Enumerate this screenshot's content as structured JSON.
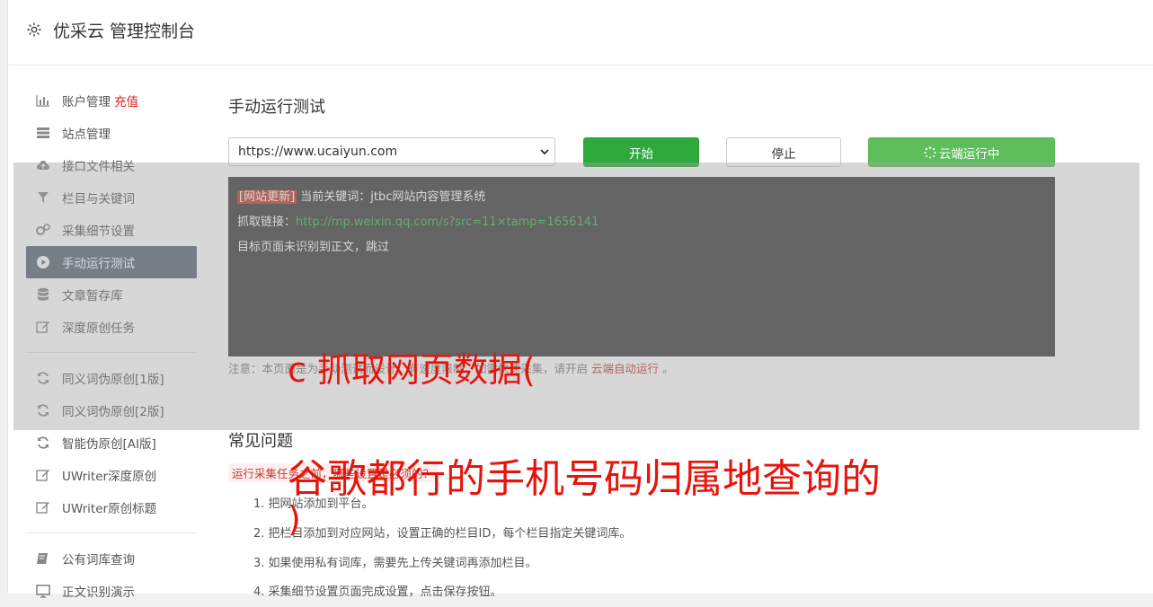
{
  "header": {
    "title": "优采云 管理控制台",
    "icon": "gear-icon"
  },
  "sidebar": {
    "group1": [
      {
        "label": "账户管理",
        "tag": "充值",
        "icon": "bar-chart-icon"
      },
      {
        "label": "站点管理",
        "icon": "list-icon"
      },
      {
        "label": "接口文件相关",
        "icon": "cloud-upload-icon"
      },
      {
        "label": "栏目与关键词",
        "icon": "filter-icon"
      },
      {
        "label": "采集细节设置",
        "icon": "cogs-icon"
      },
      {
        "label": "手动运行测试",
        "icon": "play-icon",
        "active": true
      },
      {
        "label": "文章暂存库",
        "icon": "database-icon"
      },
      {
        "label": "深度原创任务",
        "icon": "edit-icon"
      }
    ],
    "group2": [
      {
        "label": "同义词伪原创[1版]",
        "icon": "refresh-icon"
      },
      {
        "label": "同义词伪原创[2版]",
        "icon": "refresh-icon"
      },
      {
        "label": "智能伪原创[AI版]",
        "icon": "refresh-icon"
      },
      {
        "label": "UWriter深度原创",
        "icon": "edit-icon"
      },
      {
        "label": "UWriter原创标题",
        "icon": "edit-icon"
      }
    ],
    "group3": [
      {
        "label": "公有词库查询",
        "icon": "book-icon"
      },
      {
        "label": "正文识别演示",
        "icon": "monitor-icon"
      }
    ]
  },
  "main": {
    "title": "手动运行测试",
    "site_select": "https://www.ucaiyun.com",
    "start_label": "开始",
    "stop_label": "停止",
    "cloud_label": "云端运行中",
    "console": {
      "line1_tag": "[网站更新]",
      "line1_text": "当前关键词：jtbc网站内容管理系统",
      "line2_label": "抓取链接：",
      "line2_link": "http://mp.weixin.qq.com/s?src=11×tamp=1656141",
      "line3_text": "目标页面未识别到正文，跳过"
    },
    "note_prefix": "注意：本页面是为手动测试而设计，有速度限制，如需快速采集，请开启",
    "note_link": "云端自动运行",
    "note_suffix": "。",
    "faq_title": "常见问题",
    "faq_tag": "运行采集任务之前，哪些设置是必须的？",
    "faq_items": [
      "1. 把网站添加到平台。",
      "2. 把栏目添加到对应网站，设置正确的栏目ID，每个栏目指定关键词库。",
      "3. 如果使用私有词库，需要先上传关键词再添加栏目。",
      "4. 采集细节设置页面完成设置，点击保存按钮。"
    ]
  },
  "watermark": {
    "line1": "c 抓取网页数据(",
    "line2": "谷歌都行的手机号码归属地查询的",
    "line3": ")"
  }
}
